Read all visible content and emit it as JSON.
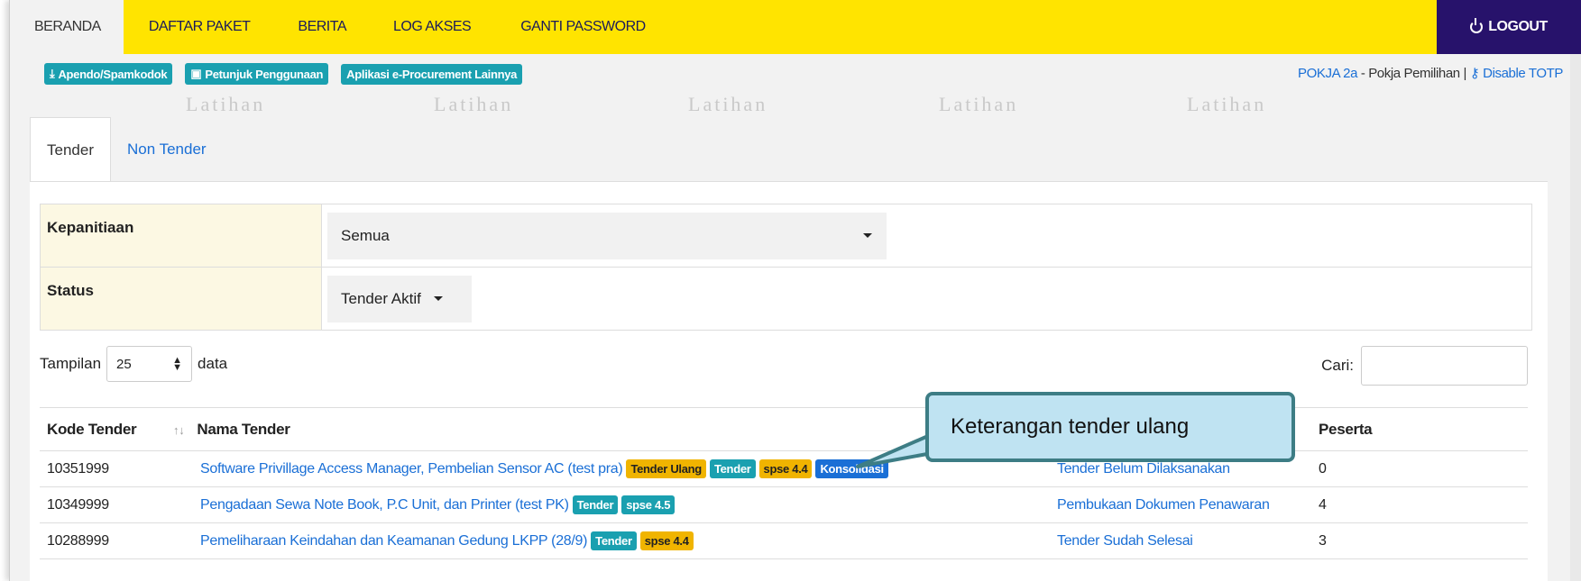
{
  "nav": {
    "items": [
      "BERANDA",
      "DAFTAR PAKET",
      "BERITA",
      "LOG AKSES",
      "GANTI PASSWORD"
    ],
    "logout": "LOGOUT",
    "accent": "#ffe400",
    "logout_bg": "#27126b"
  },
  "toolbar": {
    "buttons": [
      "Apendo/Spamkodok",
      "Petunjuk Penggunaan",
      "Aplikasi e-Procurement Lainnya"
    ],
    "user_link": "POKJA 2a",
    "user_role": " - Pokja Pemilihan | ",
    "disable_totp": "Disable TOTP"
  },
  "watermark": "Latihan",
  "tabs": [
    "Tender",
    "Non Tender"
  ],
  "filters": {
    "kepanitiaan_label": "Kepanitiaan",
    "kepanitiaan_value": "Semua",
    "status_label": "Status",
    "status_value": "Tender Aktif"
  },
  "length": {
    "prefix": "Tampilan",
    "value": "25",
    "suffix": "data"
  },
  "search": {
    "label": "Cari:",
    "value": ""
  },
  "table": {
    "headers": [
      "Kode Tender",
      "Nama Tender",
      "Peserta"
    ],
    "rows": [
      {
        "kode": "10351999",
        "nama": "Software Privillage Access Manager, Pembelian Sensor AC (test pra)",
        "badges": [
          [
            "Tender Ulang",
            "warn"
          ],
          [
            "Tender",
            "info"
          ],
          [
            "spse 4.4",
            "warn"
          ],
          [
            "Konsolidasi",
            "primary"
          ]
        ],
        "tahap": "Tender Belum Dilaksanakan",
        "peserta": "0"
      },
      {
        "kode": "10349999",
        "nama": "Pengadaan Sewa Note Book, P.C Unit, dan Printer (test PK)",
        "badges": [
          [
            "Tender",
            "info"
          ],
          [
            "spse 4.5",
            "info"
          ]
        ],
        "tahap": "Pembukaan Dokumen Penawaran",
        "peserta": "4"
      },
      {
        "kode": "10288999",
        "nama": "Pemeliharaan Keindahan dan Keamanan Gedung LKPP (28/9)",
        "badges": [
          [
            "Tender",
            "info"
          ],
          [
            "spse 4.4",
            "warn"
          ]
        ],
        "tahap": "Tender Sudah Selesai",
        "peserta": "3"
      }
    ]
  },
  "callout": "Keterangan tender ulang"
}
